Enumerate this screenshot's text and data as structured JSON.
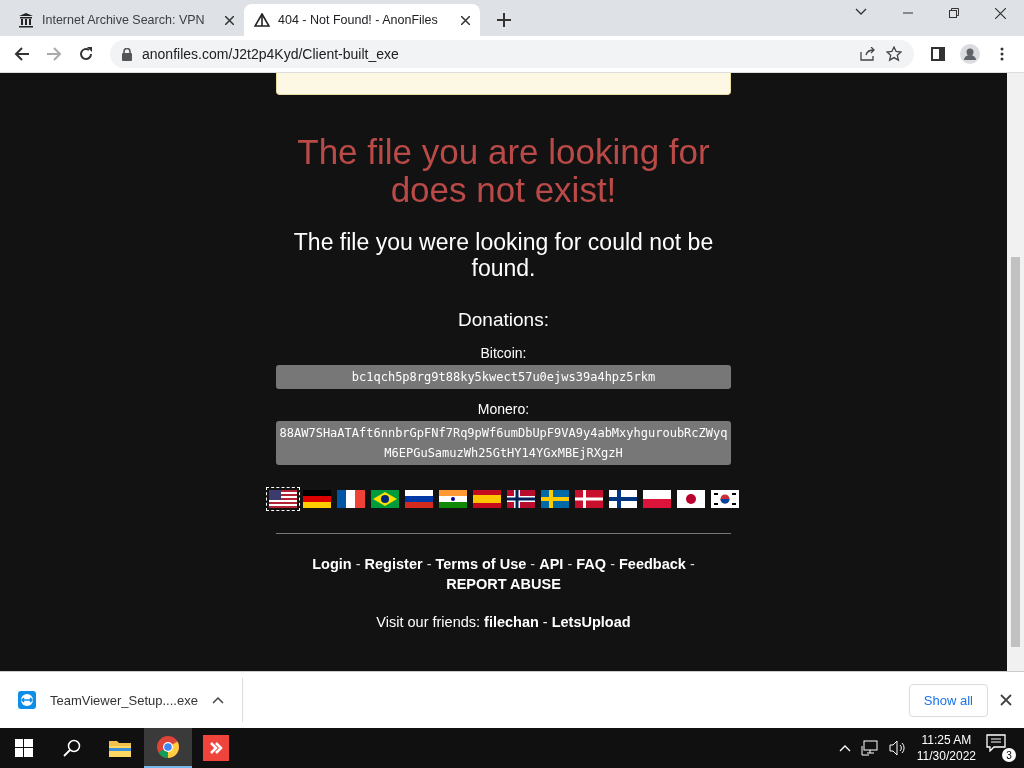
{
  "tabs": [
    {
      "title": "Internet Archive Search: VPN",
      "selected": false
    },
    {
      "title": "404 - Not Found! - AnonFiles",
      "selected": true
    }
  ],
  "address_bar": {
    "url": "anonfiles.com/J2t2p4Kyd/Client-built_exe"
  },
  "page": {
    "heading": "The file you are looking for does not exist!",
    "subheading": "The file you were looking for could not be found.",
    "donations_title": "Donations:",
    "wallets": [
      {
        "label": "Bitcoin:",
        "address": "bc1qch5p8rg9t88ky5kwect57u0ejws39a4hpz5rkm"
      },
      {
        "label": "Monero:",
        "address": "88AW7SHaATAft6nnbrGpFNf7Rq9pWf6umDbUpF9VA9y4abMxyhguroubRcZWyqM6EPGuSamuzWh25GtHY14YGxMBEjRXgzH"
      }
    ],
    "flags": [
      {
        "kind": "us",
        "selected": true
      },
      {
        "kind": "de",
        "selected": false
      },
      {
        "kind": "fr",
        "selected": false
      },
      {
        "kind": "br",
        "selected": false
      },
      {
        "kind": "ru",
        "selected": false
      },
      {
        "kind": "in",
        "selected": false
      },
      {
        "kind": "es",
        "selected": false
      },
      {
        "kind": "no",
        "selected": false
      },
      {
        "kind": "se",
        "selected": false
      },
      {
        "kind": "dk",
        "selected": false
      },
      {
        "kind": "fi",
        "selected": false
      },
      {
        "kind": "pl",
        "selected": false
      },
      {
        "kind": "jp",
        "selected": false
      },
      {
        "kind": "kr",
        "selected": false
      }
    ],
    "footer_links": [
      "Login",
      "Register",
      "Terms of Use",
      "API",
      "FAQ",
      "Feedback",
      "REPORT ABUSE"
    ],
    "separator": "-",
    "friends_label": "Visit our friends:",
    "friends": [
      "filechan",
      "LetsUpload"
    ]
  },
  "download_bar": {
    "file": "TeamViewer_Setup....exe",
    "show_all": "Show all"
  },
  "taskbar": {
    "time": "11:25 AM",
    "date": "11/30/2022",
    "notifications": "3"
  }
}
